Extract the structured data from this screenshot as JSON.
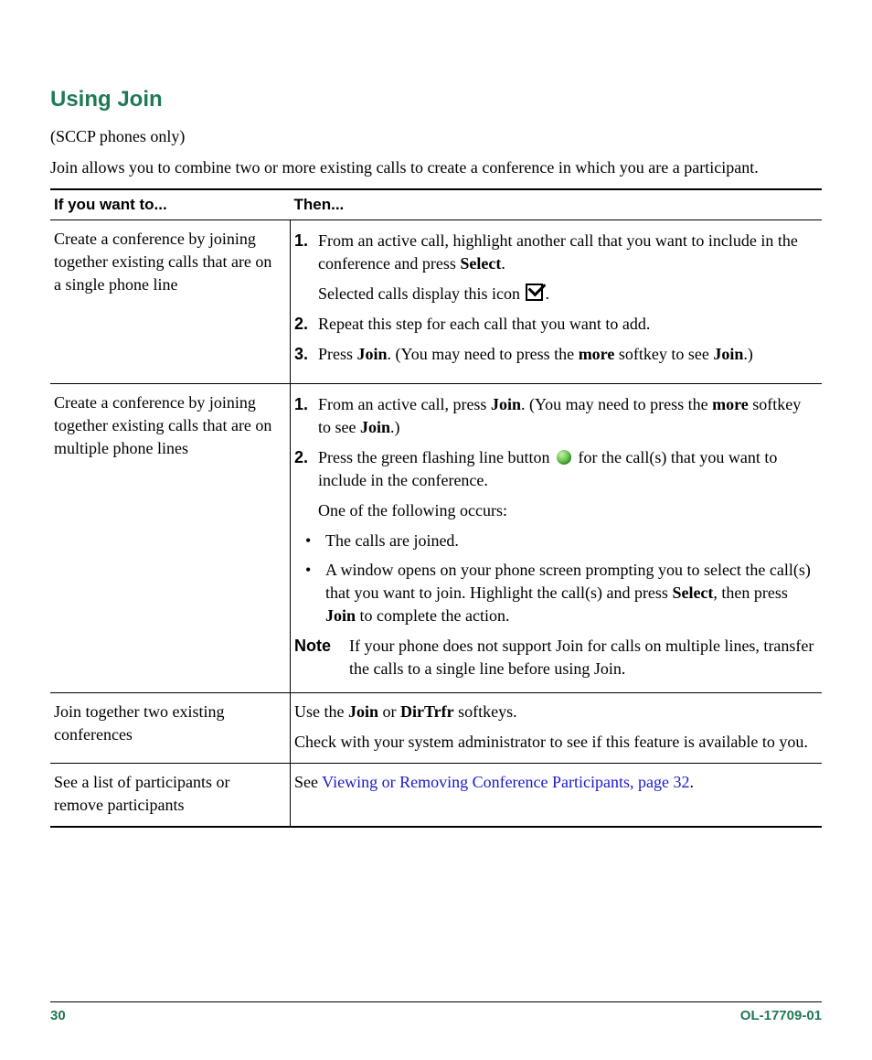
{
  "heading": "Using Join",
  "intro1": "(SCCP phones only)",
  "intro2": "Join allows you to combine two or more existing calls to create a conference in which you are a participant.",
  "th_left": "If you want to...",
  "th_right": "Then...",
  "row1": {
    "left": "Create a conference by joining together existing calls that are on a single phone line",
    "s1_num": "1.",
    "s1a": "From an active call, highlight another call that you want to include in the conference and press ",
    "s1b_bold": "Select",
    "s1c": ".",
    "s1_line2a": "Selected calls display this icon ",
    "s1_line2b": ".",
    "s2_num": "2.",
    "s2": "Repeat this step for each call that you want to add.",
    "s3_num": "3.",
    "s3a": "Press ",
    "s3b_bold": "Join",
    "s3c": ". (You may need to press the ",
    "s3d_bold": "more",
    "s3e": " softkey to see ",
    "s3f_bold": "Join",
    "s3g": ".)"
  },
  "row2": {
    "left": "Create a conference by joining together existing calls that are on multiple phone lines",
    "s1_num": "1.",
    "s1a": "From an active call, press ",
    "s1b_bold": "Join",
    "s1c": ". (You may need to press the ",
    "s1d_bold": "more",
    "s1e": " softkey to see ",
    "s1f_bold": "Join",
    "s1g": ".)",
    "s2_num": "2.",
    "s2a": "Press the green flashing line button ",
    "s2b": " for the call(s) that you want to include in the conference.",
    "s2_after": "One of the following occurs:",
    "b1": "The calls are joined.",
    "b2a": "A window opens on your phone screen prompting you to select the call(s) that you want to join. Highlight the call(s) and press ",
    "b2b_bold": "Select",
    "b2c": ", then press ",
    "b2d_bold": "Join",
    "b2e": " to complete the action.",
    "note_label": "Note",
    "note_text": "If your phone does not support Join for calls on multiple lines, transfer the calls to a single line before using Join."
  },
  "row3": {
    "left": "Join together two existing conferences",
    "r1a": "Use the ",
    "r1b_bold": "Join",
    "r1c": " or ",
    "r1d_bold": "DirTrfr",
    "r1e": " softkeys.",
    "r2": "Check with your system administrator to see if this feature is available to you."
  },
  "row4": {
    "left": "See a list of participants or remove participants",
    "r_a": "See ",
    "r_link": "Viewing or Removing Conference Participants, page 32",
    "r_b": "."
  },
  "footer_left": "30",
  "footer_right": "OL-17709-01"
}
